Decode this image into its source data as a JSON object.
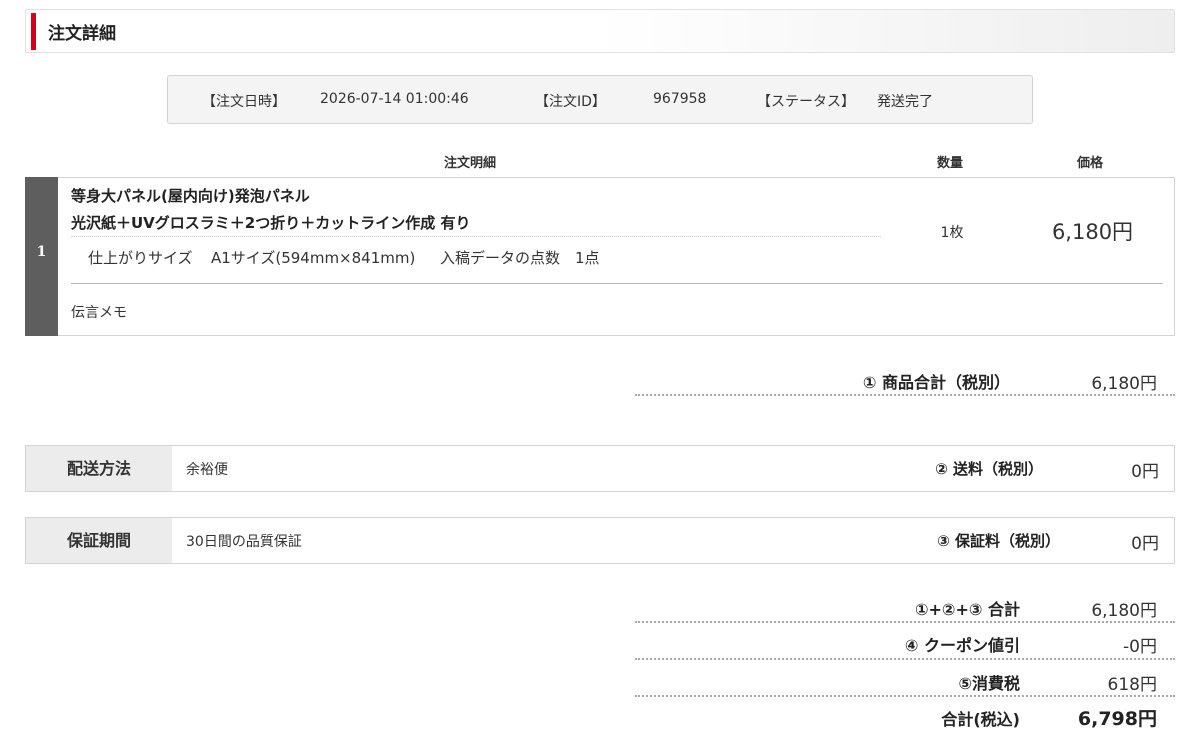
{
  "header": {
    "title": "注文詳細"
  },
  "order_info": {
    "date_label": "【注文日時】",
    "date_value": "2026-07-14 01:00:46",
    "id_label": "【注文ID】",
    "id_value": "967958",
    "status_label": "【ステータス】",
    "status_value": "発送完了"
  },
  "columns": {
    "detail": "注文明細",
    "quantity": "数量",
    "price": "価格"
  },
  "item": {
    "number": "1",
    "name": "等身大パネル(屋内向け)発泡パネル",
    "options": "光沢紙＋UVグロスラミ＋2つ折り＋カットライン作成 有り",
    "size_label": "仕上がりサイズ",
    "size_value": "A1サイズ(594mm×841mm)",
    "data_count_label": "入稿データの点数",
    "data_count_value": "1点",
    "quantity": "1枚",
    "price": "6,180円",
    "memo_label": "伝言メモ"
  },
  "subtotal": {
    "label": "① 商品合計（税別）",
    "value": "6,180円"
  },
  "shipping": {
    "heading": "配送方法",
    "method": "余裕便",
    "fee_label": "② 送料（税別）",
    "fee_value": "0円"
  },
  "warranty": {
    "heading": "保証期間",
    "description": "30日間の品質保証",
    "fee_label": "③ 保証料（税別）",
    "fee_value": "0円"
  },
  "totals": {
    "sum_label": "①+②+③ 合計",
    "sum_value": "6,180円",
    "coupon_label": "④ クーポン値引",
    "coupon_value": "-0円",
    "tax_label": "⑤消費税",
    "tax_value": "618円",
    "grand_label": "合計(税込)",
    "grand_value": "6,798円"
  },
  "colors": {
    "accent": "#d5001c",
    "number_bar": "#5e5e5e",
    "heading_bg": "#ececec"
  }
}
